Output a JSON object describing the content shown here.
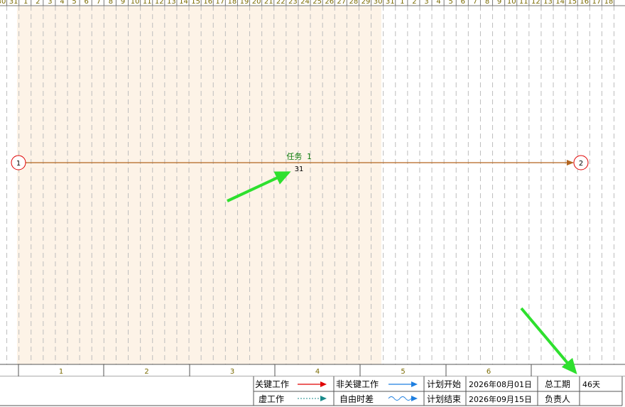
{
  "timeline": {
    "day_labels": [
      "30",
      "31",
      "1",
      "2",
      "3",
      "4",
      "5",
      "6",
      "7",
      "8",
      "9",
      "10",
      "11",
      "12",
      "13",
      "14",
      "15",
      "16",
      "17",
      "18",
      "19",
      "20",
      "21",
      "22",
      "23",
      "24",
      "25",
      "26",
      "27",
      "28",
      "29",
      "30",
      "31",
      "1",
      "2",
      "3",
      "4",
      "5",
      "6",
      "7",
      "8",
      "9",
      "10",
      "11",
      "12",
      "13",
      "14",
      "15",
      "16",
      "17",
      "18"
    ],
    "week_labels": [
      "1",
      "2",
      "3",
      "4",
      "5",
      "6"
    ],
    "highlight_start_day_index": 2,
    "highlight_end_day_index": 32,
    "colors": {
      "highlight": "#fdf3e7",
      "grid": "#bdbdbd",
      "label": "#7a6a00",
      "arrow": "#b3651f"
    }
  },
  "nodes": [
    {
      "id": "1",
      "label": "1",
      "day_index": 1.5
    },
    {
      "id": "2",
      "label": "2",
      "day_index": 48
    }
  ],
  "tasks": [
    {
      "name": "任务 1",
      "duration": "31"
    }
  ],
  "legend": {
    "critical_label": "关键工作",
    "noncritical_label": "非关键工作",
    "dummy_label": "虚工作",
    "float_label": "自由时差",
    "plan_start_label": "计划开始",
    "plan_start_value": "2026年08月01日",
    "plan_end_label": "计划结束",
    "plan_end_value": "2026年09月15日",
    "total_label": "总工期",
    "total_value": "46天",
    "owner_label": "负责人",
    "owner_value": "",
    "colors": {
      "critical": "#e00000",
      "noncritical": "#1e7fe0",
      "dummy": "#1a8a8a",
      "float": "#1e7fe0"
    }
  },
  "annotation_arrows": {
    "color": "#2ee02e"
  }
}
